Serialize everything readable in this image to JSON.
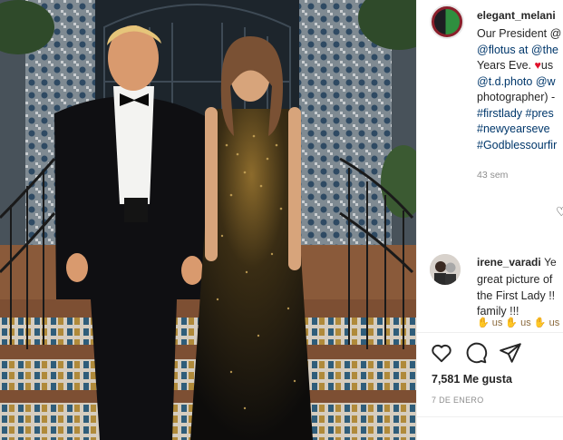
{
  "post": {
    "username": "elegant_melani",
    "caption_lines": [
      [
        "Our President @"
      ],
      [
        "@flotus at @the"
      ],
      [
        "Years Eve. ",
        "us"
      ],
      [
        "@t.d.photo @w"
      ],
      [
        "photographer) -"
      ],
      [
        "#firstlady #pres"
      ],
      [
        "#newyearseve"
      ],
      [
        "#Godblessourfir"
      ]
    ],
    "heart_glyph": "♥",
    "time_ago": "43 sem",
    "comment_like_glyph": "♡"
  },
  "comment": {
    "username": "irene_varadi",
    "text_lines": [
      "great picture of",
      "the First Lady !!",
      "family !!!"
    ],
    "first_line_suffix": "Ye",
    "emoji_row": "✋ us ✋ us ✋ us"
  },
  "actions": {
    "like": "heart-icon",
    "comment": "comment-icon",
    "share": "share-icon"
  },
  "likes": "7,581 Me gusta",
  "date": "7 DE ENERO",
  "colors": {
    "link": "#00376b",
    "text": "#262626",
    "muted": "#8e8e8e",
    "heart": "#e0112b"
  }
}
